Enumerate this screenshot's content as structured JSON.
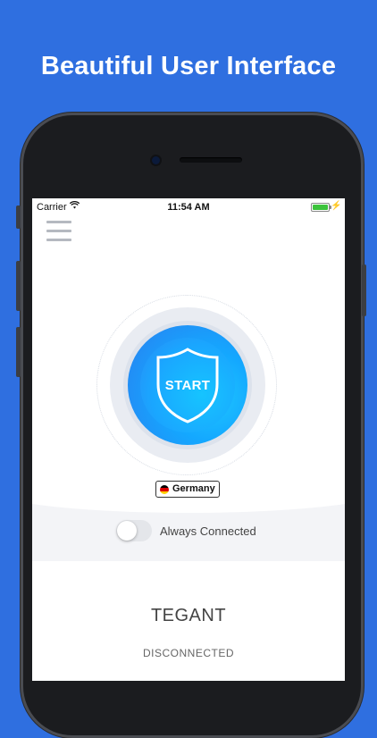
{
  "headline": "Beautiful User Interface",
  "status_bar": {
    "carrier": "Carrier",
    "time": "11:54 AM",
    "battery_color": "#3cc33c"
  },
  "menu": {
    "icon": "hamburger-menu-icon"
  },
  "connect": {
    "button_label": "START",
    "shield_icon": "shield-icon",
    "accent": "#1aa6ff"
  },
  "location": {
    "country": "Germany",
    "flag": "germany-flag-icon"
  },
  "always_connected": {
    "label": "Always Connected",
    "enabled": false
  },
  "app": {
    "name": "TEGANT",
    "status": "DISCONNECTED"
  },
  "colors": {
    "background": "#2f6fe0"
  }
}
